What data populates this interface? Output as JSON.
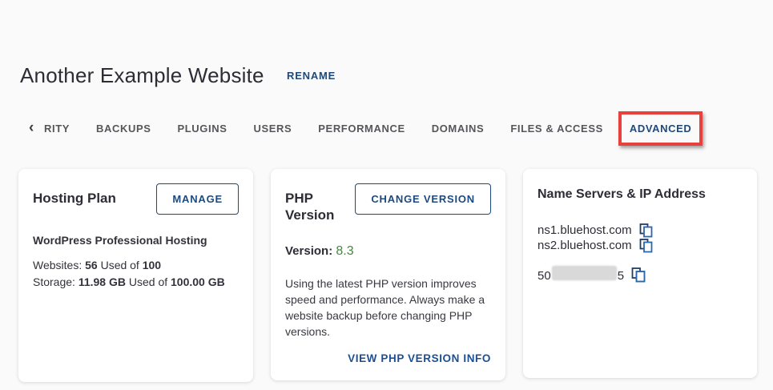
{
  "page": {
    "title": "Another Example Website",
    "rename_label": "RENAME"
  },
  "tabs": {
    "back_chevron": "‹",
    "items": [
      "RITY",
      "BACKUPS",
      "PLUGINS",
      "USERS",
      "PERFORMANCE",
      "DOMAINS",
      "FILES & ACCESS",
      "ADVANCED"
    ],
    "active": "ADVANCED"
  },
  "hosting_plan_card": {
    "title": "Hosting Plan",
    "manage_button": "MANAGE",
    "plan_name": "WordPress Professional Hosting",
    "websites": {
      "label": "Websites: ",
      "used": "56",
      "sep": " Used of ",
      "total": "100"
    },
    "storage": {
      "label": "Storage: ",
      "used": "11.98 GB",
      "sep": " Used of ",
      "total": "100.00 GB"
    }
  },
  "php_card": {
    "title": "PHP Version",
    "change_button": "CHANGE VERSION",
    "version_label": "Version: ",
    "version_value": "8.3",
    "description": "Using the latest PHP version improves speed and performance. Always make a website backup before changing PHP versions.",
    "info_link": "VIEW PHP VERSION INFO"
  },
  "name_servers_card": {
    "title": "Name Servers & IP Address",
    "ns1": "ns1.bluehost.com",
    "ns2": "ns2.bluehost.com",
    "ip_prefix": "50",
    "ip_suffix": "5"
  },
  "icons": {
    "copy": "copy-icon",
    "back_chevron": "chevron-left-icon"
  },
  "colors": {
    "accent_navy": "#1d4a7e",
    "link_blue": "#1b4f93",
    "version_green": "#428a3f",
    "tab_gray": "#56565b",
    "annotation_red": "#e8413c",
    "background": "#fafafa",
    "card_white": "#ffffff",
    "redaction_gray": "#d9d9d9"
  }
}
